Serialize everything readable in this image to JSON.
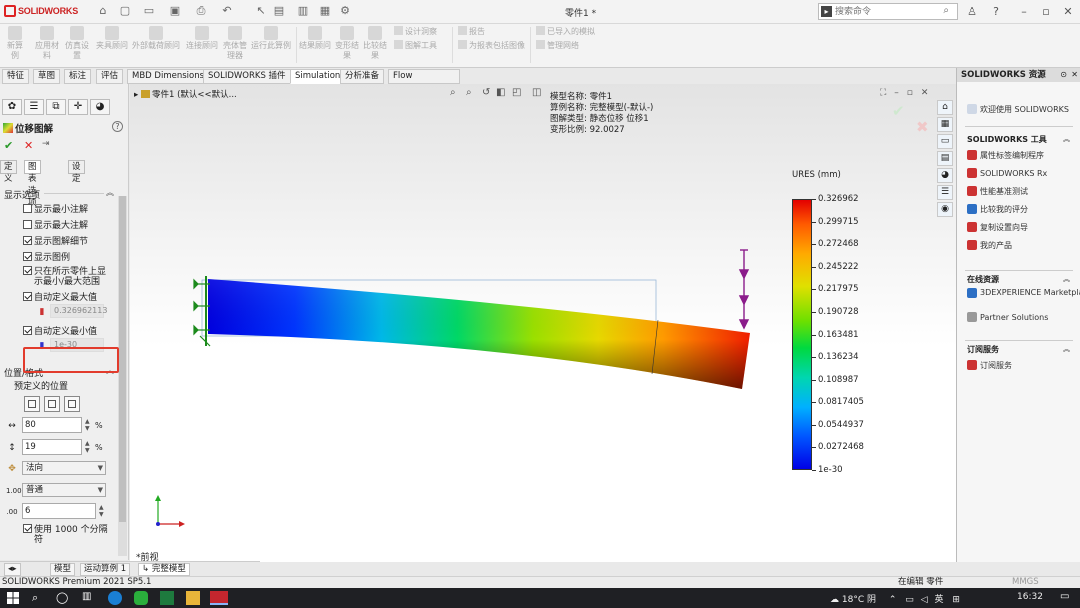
{
  "app": {
    "brand": "SOLIDWORKS",
    "document_title": "零件1 *"
  },
  "search": {
    "placeholder": "搜索命令"
  },
  "ribbon": {
    "buttons": [
      "新算例",
      "应用材料",
      "仿真设置",
      "夹具顾问",
      "外部载荷顾问",
      "连接顾问",
      "壳体管理器",
      "运行此算例",
      "结果顾问",
      "变形结果",
      "比较结果"
    ],
    "small": [
      "设计洞察",
      "图解工具",
      "报告",
      "为报表包括图像",
      "已导入的模拟",
      "管理网络"
    ]
  },
  "tabs": [
    "特征",
    "草图",
    "标注",
    "评估",
    "MBD Dimensions",
    "SOLIDWORKS 插件",
    "Simulation",
    "分析准备",
    "Flow Simulation"
  ],
  "active_tab": "Simulation",
  "property_manager": {
    "title": "位移图解",
    "subtabs": [
      "定义",
      "图表选项",
      "设定"
    ],
    "display_section": "显示选项",
    "checkboxes": [
      {
        "label": "显示最小注解",
        "checked": false
      },
      {
        "label": "显示最大注解",
        "checked": false
      },
      {
        "label": "显示图解细节",
        "checked": true
      },
      {
        "label": "显示图例",
        "checked": true
      }
    ],
    "highlight_option": {
      "line1": "只在所示零件上显",
      "line2": "示最小/最大范围",
      "checked": true
    },
    "auto_max": {
      "label": "自动定义最大值",
      "checked": true,
      "value": "0.326962113"
    },
    "auto_min": {
      "label": "自动定义最小值",
      "checked": true,
      "value": "1e-30"
    },
    "position_section": "位置/格式",
    "predefined_label": "预定义的位置",
    "x_percent": "80",
    "y_percent": "19",
    "percent_sign": "%",
    "orientation": "法向",
    "number_format": "普通",
    "decimals": "6",
    "divisions": {
      "line1": "使用 1000 个分隔",
      "line2": "符"
    }
  },
  "viewport": {
    "tree_label": "零件1 (默认<<默认...",
    "info": [
      "模型名称: 零件1",
      "算例名称: 完整模型(-默认-)",
      "图解类型: 静态位移 位移1",
      "变形比例: 92.0027"
    ],
    "legend_title": "URES (mm)",
    "legend_ticks": [
      "0.326962",
      "0.299715",
      "0.272468",
      "0.245222",
      "0.217975",
      "0.190728",
      "0.163481",
      "0.136234",
      "0.108987",
      "0.0817405",
      "0.0544937",
      "0.0272468",
      "1e-30"
    ],
    "view_label": "*前视"
  },
  "chart_data": {
    "type": "heatmap",
    "title": "URES (mm)",
    "colorbar_max": 0.326962,
    "colorbar_min": 1e-30,
    "tick_values": [
      0.326962,
      0.299715,
      0.272468,
      0.245222,
      0.217975,
      0.190728,
      0.163481,
      0.136234,
      0.108987,
      0.0817405,
      0.0544937,
      0.0272468,
      1e-30
    ]
  },
  "task_pane": {
    "title": "SOLIDWORKS 资源",
    "welcome": "欢迎使用 SOLIDWORKS",
    "tools_section": "SOLIDWORKS 工具",
    "tools": [
      "属性标签编制程序",
      "SOLIDWORKS Rx",
      "性能基准测试",
      "比较我的评分",
      "复制设置向导",
      "我的产品"
    ],
    "online_section": "在线资源",
    "online": [
      "3DEXPERIENCE Marketplace",
      "Partner Solutions"
    ],
    "subscription_section": "订阅服务",
    "subscription": [
      "订阅服务"
    ]
  },
  "bottom_tabs": [
    "模型",
    "运动算例 1",
    "完整模型"
  ],
  "status": {
    "left": "SOLIDWORKS Premium 2021 SP5.1",
    "mode": "在编辑 零件",
    "units": "MMGS"
  },
  "taskbar": {
    "weather": "18°C 阴",
    "time": "16:32",
    "ime": "英"
  }
}
